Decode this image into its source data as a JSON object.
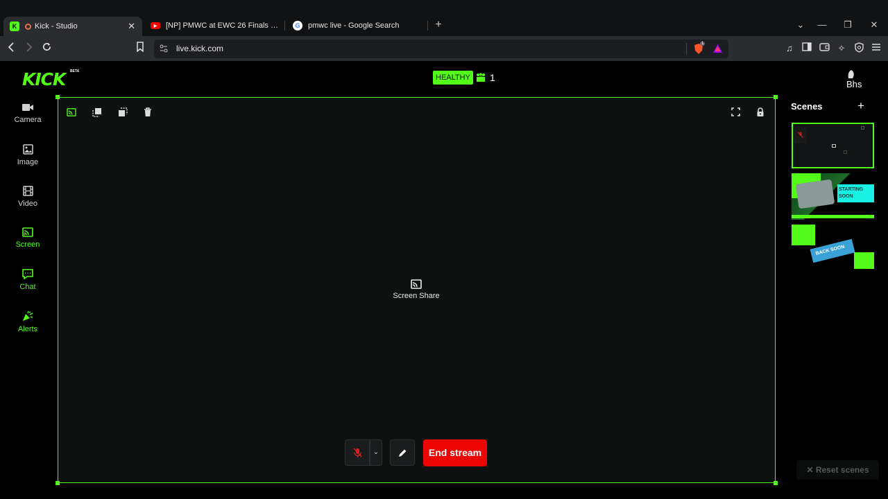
{
  "browser": {
    "tabs": [
      {
        "title": "Kick - Studio",
        "active": true
      },
      {
        "title": "[NP] PMWC at EWC 26 Finals D1 | PU",
        "active": false
      },
      {
        "title": "pmwc live - Google Search",
        "active": false
      }
    ],
    "new_tab": "+",
    "url": "live.kick.com",
    "brave_badge": "1"
  },
  "app": {
    "logo": "KICK",
    "logo_badge": "BETA",
    "status": "HEALTHY",
    "viewer_count": "1",
    "avatar_text": "Bhs",
    "sidebar": [
      {
        "label": "Camera",
        "icon": "camera-icon",
        "active": false
      },
      {
        "label": "Image",
        "icon": "image-icon",
        "active": false
      },
      {
        "label": "Video",
        "icon": "film-icon",
        "active": false
      },
      {
        "label": "Screen",
        "icon": "screen-share-icon",
        "active": true
      },
      {
        "label": "Chat",
        "icon": "chat-icon",
        "active": true
      },
      {
        "label": "Alerts",
        "icon": "party-popper-icon",
        "active": true
      }
    ],
    "canvas_source_label": "Screen Share",
    "end_stream_label": "End stream",
    "scenes_title": "Scenes",
    "scenes_add": "+",
    "scene_thumbs": [
      {
        "text": "",
        "selected": true
      },
      {
        "text": "STARTING SOON",
        "selected": false
      },
      {
        "text": "BACK SOON",
        "selected": false
      }
    ],
    "reset_label": "Reset scenes",
    "reset_icon": "✕",
    "colors": {
      "accent": "#53fc18",
      "danger": "#eb0400",
      "canvas": "#0e1311"
    }
  }
}
